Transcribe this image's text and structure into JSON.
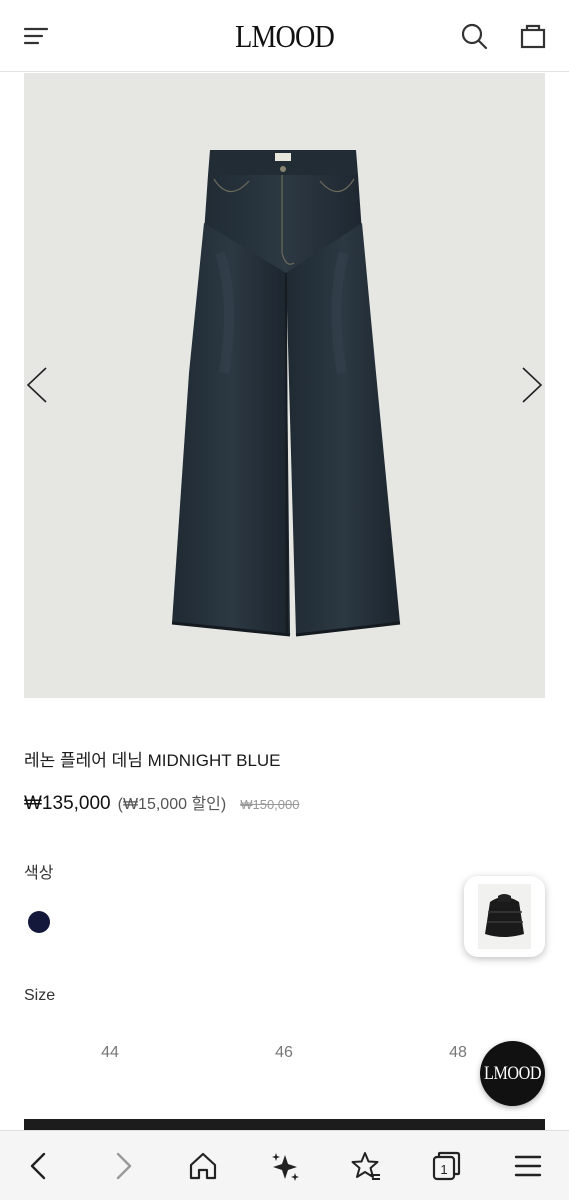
{
  "header": {
    "logo": "LMOOD",
    "icons": [
      "hamburger-menu-icon",
      "search-icon",
      "shopping-bag-icon"
    ]
  },
  "gallery": {
    "icons": [
      "chevron-left-icon",
      "chevron-right-icon"
    ]
  },
  "product": {
    "title": "레논 플레어 데님 MIDNIGHT BLUE",
    "price": "₩135,000",
    "discount": "(₩15,000 할인)",
    "original_price": "₩150,000"
  },
  "options": {
    "color_label": "색상",
    "color_swatch": "#14183a",
    "size_label": "Size",
    "sizes": [
      "44",
      "46",
      "48"
    ]
  },
  "floating": {
    "logo_button": "LMOOD"
  },
  "browser_nav": {
    "icons": [
      "back-icon",
      "forward-icon",
      "home-icon",
      "sparkle-icon",
      "bookmark-star-icon",
      "tabs-icon",
      "menu-icon"
    ],
    "tab_count": "1"
  }
}
